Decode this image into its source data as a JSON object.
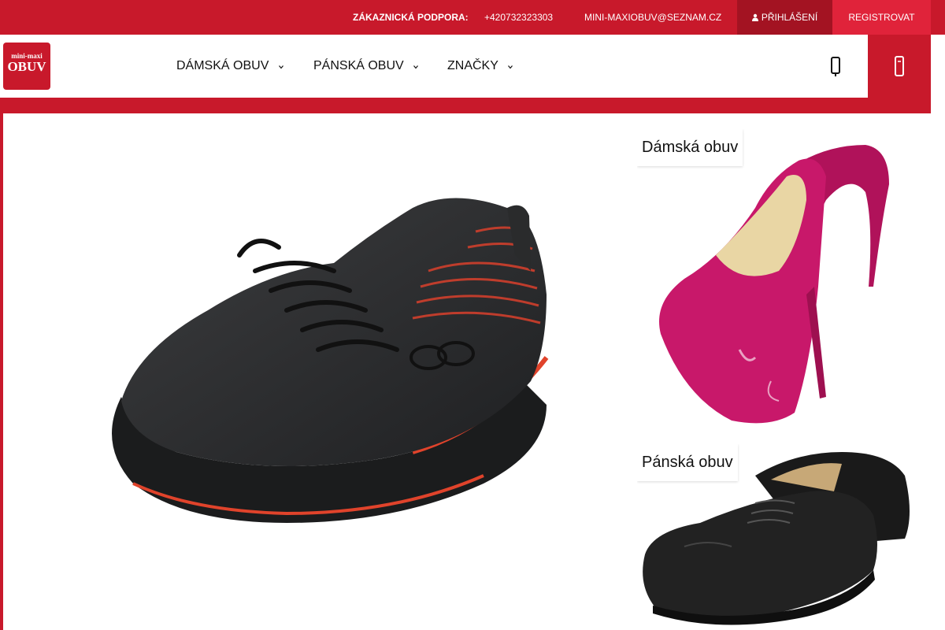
{
  "topbar": {
    "support_label": "ZÁKAZNICKÁ PODPORA:",
    "phone": "+420732323303",
    "email": "MINI-MAXIOBUV@SEZNAM.CZ",
    "login_label": "PŘIHLÁŠENÍ",
    "register_label": "REGISTROVAT"
  },
  "logo": {
    "small": "mini-maxi",
    "big": "OBUV"
  },
  "nav": {
    "items": [
      {
        "label": "DÁMSKÁ OBUV"
      },
      {
        "label": "PÁNSKÁ OBUV"
      },
      {
        "label": "ZNAČKY"
      }
    ]
  },
  "categories": {
    "women_label": "Dámská obuv",
    "men_label": "Pánská obuv"
  },
  "icons": {
    "login": "user-icon",
    "search": "search-icon",
    "cart": "cart-icon",
    "caret": "chevron-down-icon",
    "slider_prev": "chevron-left-icon"
  },
  "colors": {
    "brand_red": "#c8192b",
    "login_bg": "#a31322",
    "register_bg": "#e0233a"
  }
}
